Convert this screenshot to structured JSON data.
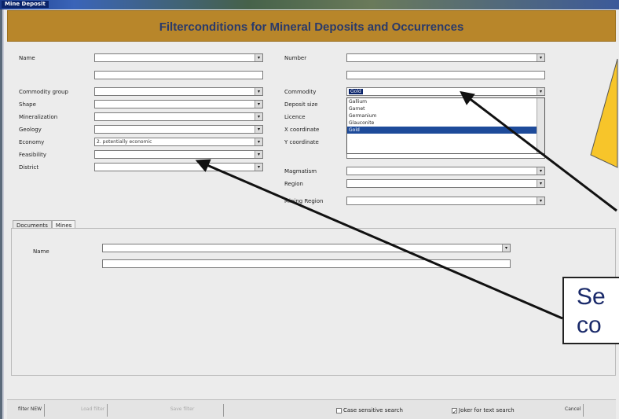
{
  "window": {
    "title": "Mine Deposit"
  },
  "banner": {
    "title": "Filterconditions for Mineral Deposits and Occurrences"
  },
  "form_left": [
    {
      "label": "Name",
      "value": ""
    },
    {
      "label": "Commodity group",
      "value": ""
    },
    {
      "label": "Shape",
      "value": ""
    },
    {
      "label": "Mineralization",
      "value": ""
    },
    {
      "label": "Geology",
      "value": ""
    },
    {
      "label": "Economy",
      "value": "2. potentially economic"
    },
    {
      "label": "Feasibility",
      "value": ""
    },
    {
      "label": "District",
      "value": ""
    }
  ],
  "form_right": [
    {
      "label": "Number",
      "value": ""
    },
    {
      "label": "Commodity",
      "value": "Gold"
    },
    {
      "label": "Deposit size",
      "value": ""
    },
    {
      "label": "Licence",
      "value": ""
    },
    {
      "label": "X coordinate",
      "value": ""
    },
    {
      "label": "Y coordinate",
      "value": ""
    },
    {
      "label": "Magmatism",
      "value": ""
    },
    {
      "label": "Region",
      "value": ""
    },
    {
      "label": "Mining Region",
      "value": ""
    }
  ],
  "commodity_dropdown": {
    "items": [
      "Gallium",
      "Garnet",
      "Germanium",
      "Glauconite",
      "Gold"
    ],
    "highlighted": "Gold"
  },
  "tabs": [
    "Documents",
    "Mines"
  ],
  "mines_panel": {
    "name_label": "Name",
    "name_value": ""
  },
  "bottom": {
    "new_button": "filter NEW",
    "btn2": "Load filter",
    "btn3": "Save filter",
    "chk1": "Case sensitive search",
    "chk2": "Joker for text search",
    "cancel": "Cancel"
  },
  "callout": {
    "line1": "Se",
    "line2": "co"
  },
  "colors": {
    "banner": "#b8862a",
    "callout": "#f7c52a",
    "selection": "#0a246a"
  }
}
